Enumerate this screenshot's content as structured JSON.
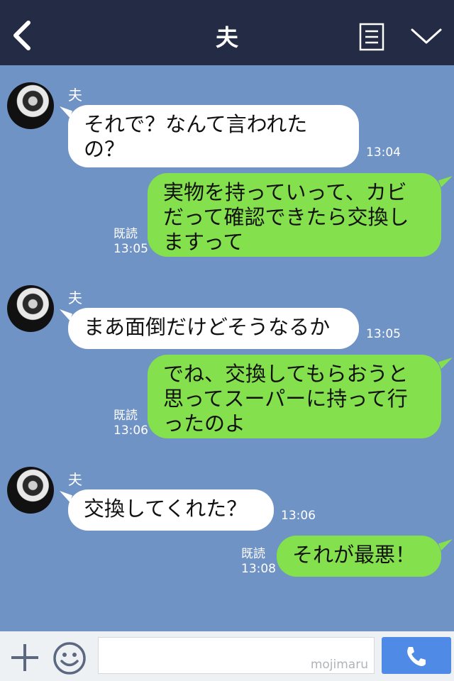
{
  "header": {
    "title": "夫"
  },
  "messages": [
    {
      "dir": "in",
      "sender": "夫",
      "text": "それで？なんて言われたの？",
      "time": "13:04"
    },
    {
      "dir": "out",
      "text": "実物を持っていって、カビだって確認できたら交換しますって",
      "read": "既読",
      "time": "13:05"
    },
    {
      "dir": "in",
      "sender": "夫",
      "text": "まあ面倒だけどそうなるか",
      "time": "13:05"
    },
    {
      "dir": "out",
      "text": "でね、交換してもらおうと思ってスーパーに持って行ったのよ",
      "read": "既読",
      "time": "13:06"
    },
    {
      "dir": "in",
      "sender": "夫",
      "text": "交換してくれた？",
      "time": "13:06"
    },
    {
      "dir": "out",
      "text": "それが最悪！",
      "read": "既読",
      "time": "13:08"
    }
  ],
  "footer": {
    "input_value": "",
    "watermark": "mojimaru"
  },
  "colors": {
    "header_bg": "#232b45",
    "chat_bg": "#7093c5",
    "outgoing_bubble": "#84e04c",
    "incoming_bubble": "#ffffff",
    "call_button": "#4f8be6"
  },
  "icons": {
    "back": "chevron-left-icon",
    "notes": "notes-icon",
    "menu": "chevron-down-icon",
    "add": "plus-icon",
    "sticker": "smiley-icon",
    "call": "phone-icon"
  }
}
